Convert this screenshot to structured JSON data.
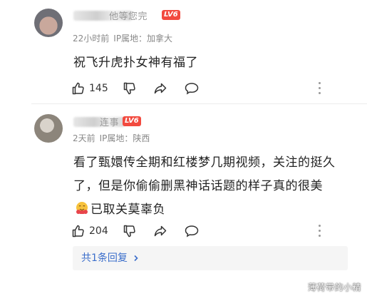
{
  "comments": [
    {
      "user_name_visible": "他等您完",
      "level_badge": "LV6",
      "time": "22小时前",
      "ip_location": "IP属地：加拿大",
      "text": "祝飞升虎扑女神有福了",
      "likes": "145"
    },
    {
      "user_name_visible": "连事",
      "level_badge": "LV6",
      "time": "2天前",
      "ip_location": "IP属地：陕西",
      "text": "看了甄嬛传全期和红楼梦几期视频，关注的挺久了，但是你偷偷删黑神话话题的样子真的很美",
      "text_after_emoji": "已取关莫辜负",
      "emoji": "hugging-face-emoji",
      "likes": "204",
      "reply_summary": "共1条回复"
    }
  ],
  "icons": {
    "like": "thumbs-up-icon",
    "dislike": "thumbs-down-icon",
    "share": "share-icon",
    "comment": "comment-bubble-icon",
    "more": "more-vertical-icon",
    "reply_chevron": "chevron-right-icon"
  },
  "colors": {
    "badge_red": "#f24a3f",
    "link_blue": "#3b6ecb",
    "meta_gray": "#888888"
  },
  "watermark": "薄荷带的小精"
}
